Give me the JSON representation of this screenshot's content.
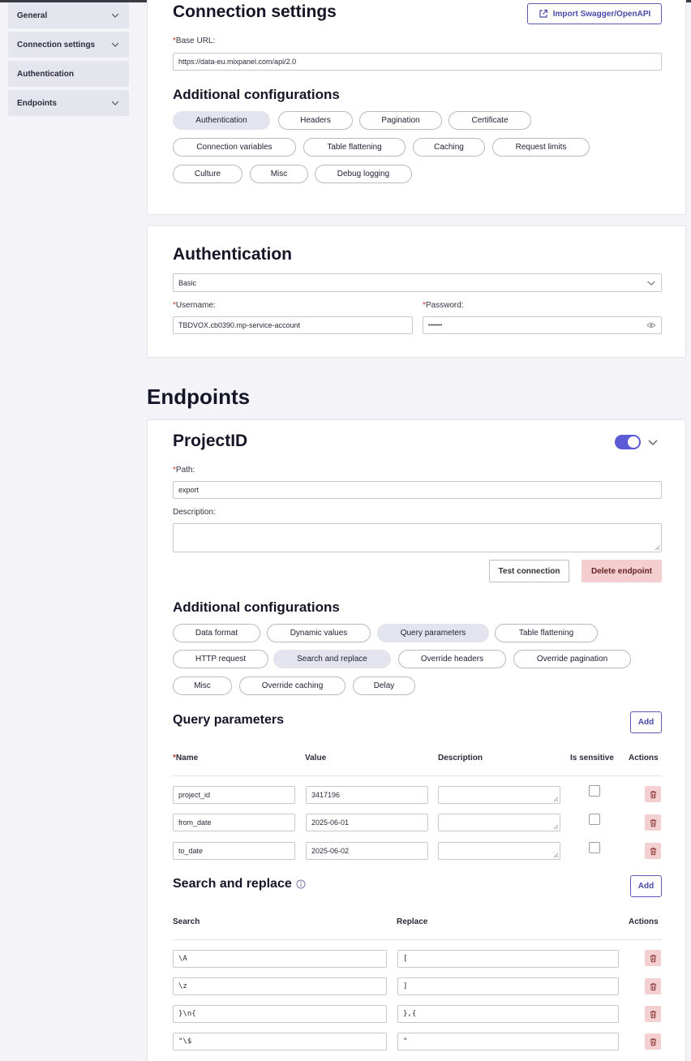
{
  "sidebar": {
    "items": [
      {
        "label": "General",
        "has_chevron": true
      },
      {
        "label": "Connection settings",
        "has_chevron": true
      },
      {
        "label": "Authentication",
        "has_chevron": false
      },
      {
        "label": "Endpoints",
        "has_chevron": true
      }
    ]
  },
  "connection": {
    "title": "Connection settings",
    "import_label": "Import Swagger/OpenAPI",
    "base_url_label": "Base URL:",
    "base_url_value": "https://data-eu.mixpanel.com/api/2.0",
    "additional_title": "Additional configurations",
    "chips": [
      "Authentication",
      "Headers",
      "Pagination",
      "Certificate",
      "Connection variables",
      "Table flattening",
      "Caching",
      "Request limits",
      "Culture",
      "Misc",
      "Debug logging"
    ],
    "active_chip": "Authentication"
  },
  "auth": {
    "title": "Authentication",
    "method_value": "Basic",
    "username_label": "Username:",
    "username_value": "TBDVOX.cb0390.mp-service-account",
    "password_label": "Password:",
    "password_value": "•••••••"
  },
  "endpoints": {
    "title": "Endpoints",
    "endpoint": {
      "name": "ProjectID",
      "enabled": true,
      "path_label": "Path:",
      "path_value": "export",
      "description_label": "Description:",
      "description_value": "",
      "test_label": "Test connection",
      "delete_label": "Delete endpoint",
      "additional_title": "Additional configurations",
      "chips": [
        "Data format",
        "Dynamic values",
        "Query parameters",
        "Table flattening",
        "HTTP request",
        "Search and replace",
        "Override headers",
        "Override pagination",
        "Misc",
        "Override caching",
        "Delay"
      ],
      "active_chips": [
        "Query parameters",
        "Search and replace"
      ],
      "query": {
        "title": "Query parameters",
        "add_label": "Add",
        "headers": {
          "name": "Name",
          "value": "Value",
          "description": "Description",
          "sensitive": "Is sensitive",
          "actions": "Actions"
        },
        "rows": [
          {
            "name": "project_id",
            "value": "3417196",
            "description": "",
            "sensitive": false
          },
          {
            "name": "from_date",
            "value": "2025-06-01",
            "description": "",
            "sensitive": false
          },
          {
            "name": "to_date",
            "value": "2025-06-02",
            "description": "",
            "sensitive": false
          }
        ]
      },
      "replace": {
        "title": "Search and replace",
        "add_label": "Add",
        "headers": {
          "search": "Search",
          "replace": "Replace",
          "actions": "Actions"
        },
        "rows": [
          {
            "search": "\\A",
            "replace": "["
          },
          {
            "search": "\\z",
            "replace": "]"
          },
          {
            "search": "}\\n{",
            "replace": "},{"
          },
          {
            "search": "\"\\$",
            "replace": "\""
          }
        ]
      }
    }
  }
}
